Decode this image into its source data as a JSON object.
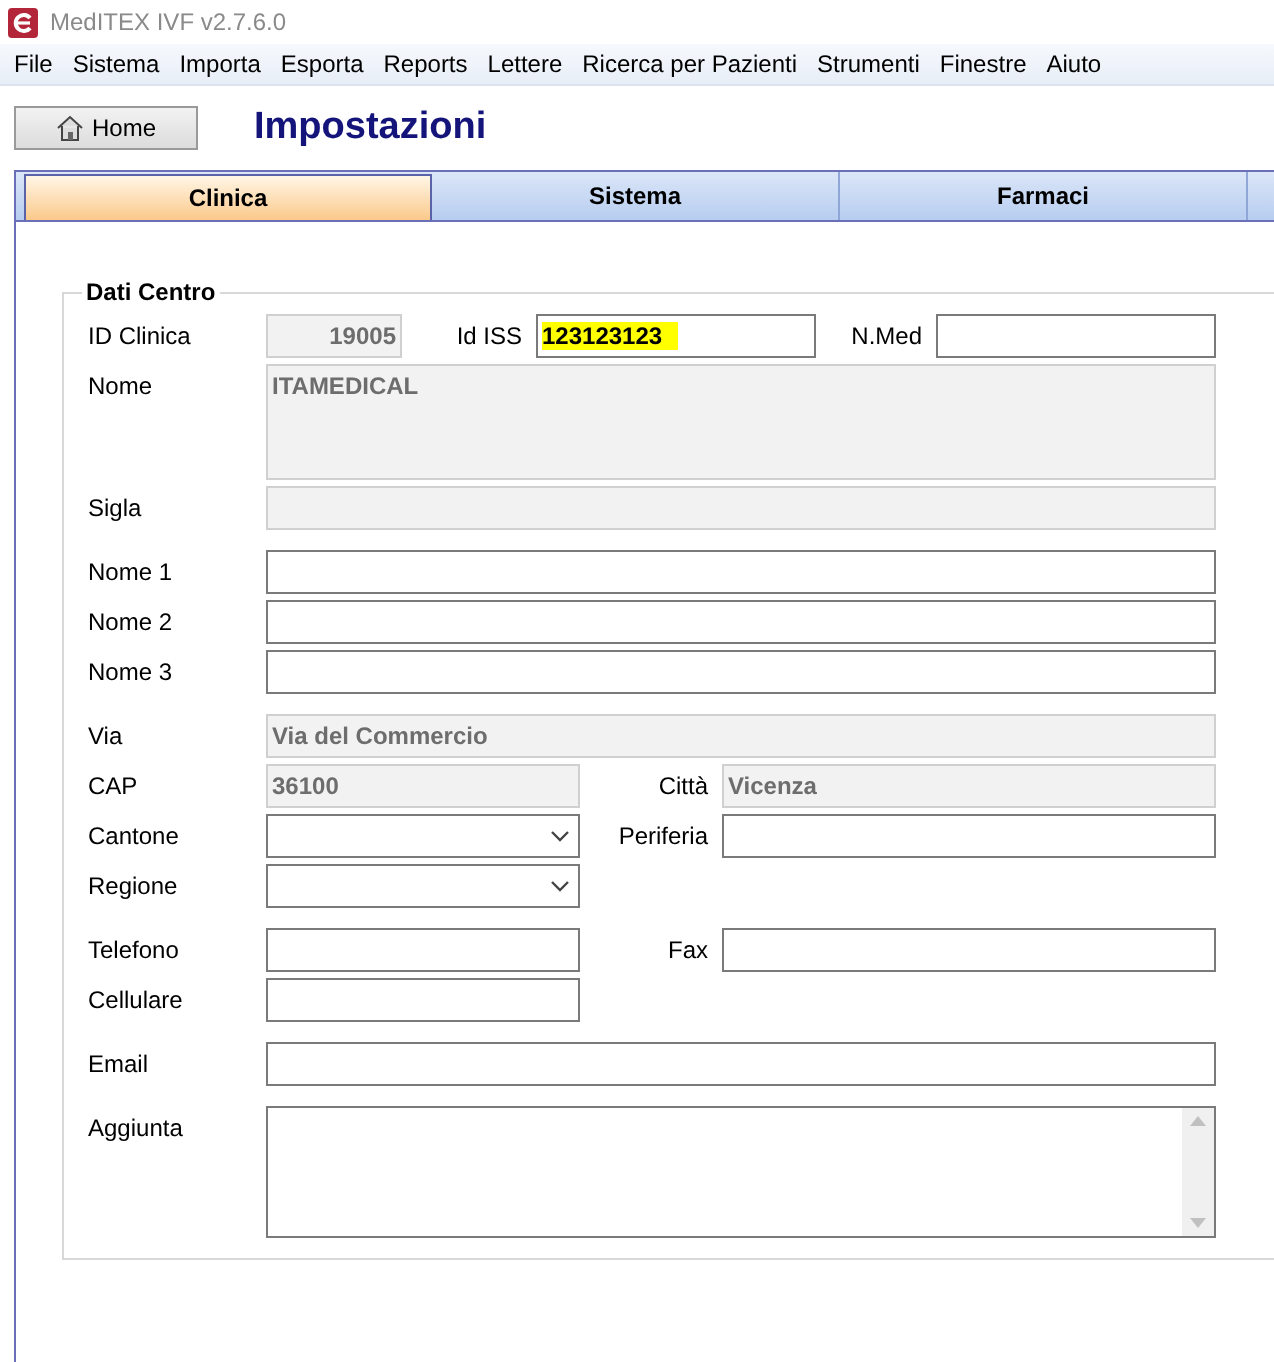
{
  "window": {
    "title": "MedITEX IVF v2.7.6.0"
  },
  "menu": [
    "File",
    "Sistema",
    "Importa",
    "Esporta",
    "Reports",
    "Lettere",
    "Ricerca per Pazienti",
    "Strumenti",
    "Finestre",
    "Aiuto"
  ],
  "home_button": "Home",
  "page_title": "Impostazioni",
  "tabs": [
    {
      "label": "Clinica",
      "selected": true
    },
    {
      "label": "Sistema",
      "selected": false
    },
    {
      "label": "Farmaci",
      "selected": false
    }
  ],
  "section": {
    "title": "Dati Centro",
    "groups": [
      {
        "rows": [
          {
            "kind": "triple",
            "fields": [
              {
                "label": "ID Clinica",
                "kind": "number",
                "value": "19005",
                "readonly": true,
                "highlighted": false
              },
              {
                "label": "Id ISS",
                "kind": "text",
                "value": "123123123",
                "readonly": false,
                "highlighted": true
              },
              {
                "label": "N.Med",
                "kind": "text",
                "readonly": false
              }
            ]
          },
          {
            "kind": "single",
            "fields": [
              {
                "label": "Nome",
                "kind": "textarea",
                "value": "ITAMEDICAL",
                "readonly": true,
                "highlighted": false
              }
            ]
          },
          {
            "kind": "single",
            "fields": [
              {
                "label": "Sigla",
                "kind": "text",
                "readonly": true
              }
            ]
          }
        ]
      },
      {
        "rows": [
          {
            "kind": "single",
            "fields": [
              {
                "label": "Nome 1",
                "kind": "text",
                "readonly": false
              }
            ]
          },
          {
            "kind": "single",
            "fields": [
              {
                "label": "Nome 2",
                "kind": "text",
                "readonly": false
              }
            ]
          },
          {
            "kind": "single",
            "fields": [
              {
                "label": "Nome 3",
                "kind": "text",
                "readonly": false
              }
            ]
          }
        ]
      },
      {
        "rows": [
          {
            "kind": "single",
            "fields": [
              {
                "label": "Via",
                "kind": "text",
                "value": "Via del Commercio",
                "readonly": true,
                "highlighted": false
              }
            ]
          },
          {
            "kind": "pair",
            "fields": [
              {
                "label": "CAP",
                "kind": "text",
                "value": "36100",
                "readonly": true,
                "highlighted": false
              },
              {
                "label": "Città",
                "kind": "text",
                "value": "Vicenza",
                "readonly": true,
                "highlighted": false
              }
            ]
          },
          {
            "kind": "pair",
            "fields": [
              {
                "label": "Cantone",
                "kind": "select",
                "readonly": false
              },
              {
                "label": "Periferia",
                "kind": "text",
                "readonly": false
              }
            ]
          },
          {
            "kind": "pair",
            "fields": [
              {
                "label": "Regione",
                "kind": "select",
                "readonly": false
              }
            ]
          }
        ]
      },
      {
        "rows": [
          {
            "kind": "pair",
            "fields": [
              {
                "label": "Telefono",
                "kind": "text",
                "readonly": false
              },
              {
                "label": "Fax",
                "kind": "text",
                "readonly": false
              }
            ]
          },
          {
            "kind": "pair",
            "fields": [
              {
                "label": "Cellulare",
                "kind": "text",
                "readonly": false
              }
            ]
          }
        ]
      },
      {
        "rows": [
          {
            "kind": "single",
            "fields": [
              {
                "label": "Email",
                "kind": "text",
                "readonly": false
              }
            ]
          }
        ]
      },
      {
        "rows": [
          {
            "kind": "single",
            "fields": [
              {
                "label": "Aggiunta",
                "kind": "memo",
                "readonly": false
              }
            ]
          }
        ]
      }
    ]
  }
}
